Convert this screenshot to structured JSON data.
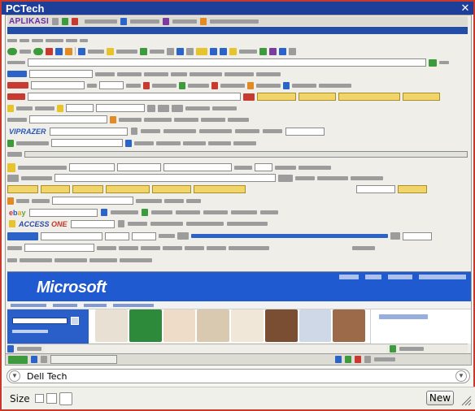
{
  "window": {
    "title": "PCTech",
    "close_glyph": "✕"
  },
  "toolbars": {
    "aplikasi_label": "APLIKASI",
    "viprazer_label": "VIPRAZER",
    "accessone_label_access": "ACCESS",
    "accessone_label_one": "ONE",
    "ebay_e": "e",
    "ebay_b": "b",
    "ebay_a": "a",
    "ebay_y": "y"
  },
  "webpage": {
    "logo": "Microsoft"
  },
  "navigator": {
    "selected": "Dell Tech",
    "left_icon": "chevron-down-icon",
    "right_icon": "chevron-down-icon"
  },
  "footer": {
    "size_label": "Size",
    "new_label": "New"
  },
  "colors": {
    "title_bar": "#1d3f9a",
    "frame_border": "#c8392b",
    "ms_blue": "#1f5ad1"
  }
}
